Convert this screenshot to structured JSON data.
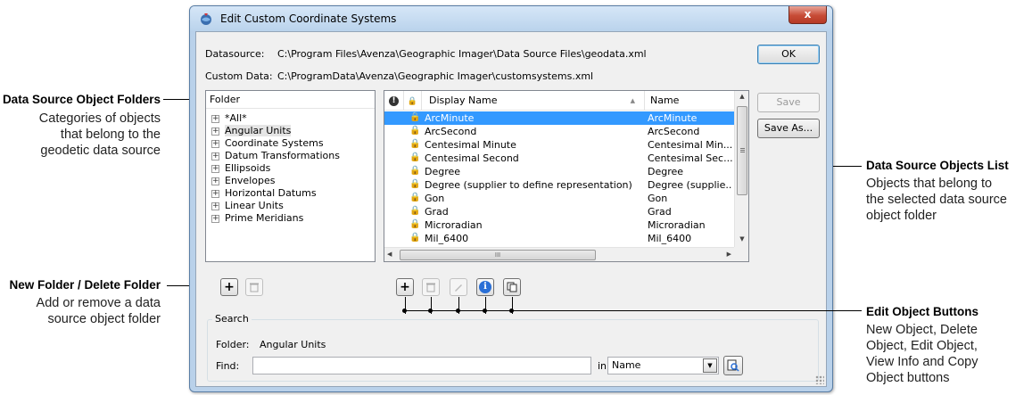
{
  "window": {
    "title": "Edit Custom Coordinate Systems",
    "close_glyph": "x"
  },
  "datasource": {
    "label": "Datasource:",
    "value": "C:\\Program Files\\Avenza\\Geographic Imager\\Data Source Files\\geodata.xml"
  },
  "custom_data": {
    "label": "Custom Data:",
    "value": "C:\\ProgramData\\Avenza\\Geographic Imager\\customsystems.xml"
  },
  "buttons": {
    "ok": "OK",
    "save": "Save",
    "save_as": "Save As..."
  },
  "folder_tree": {
    "header": "Folder",
    "items": [
      {
        "label": "*All*",
        "selected": false
      },
      {
        "label": "Angular Units",
        "selected": true
      },
      {
        "label": "Coordinate Systems",
        "selected": false
      },
      {
        "label": "Datum Transformations",
        "selected": false
      },
      {
        "label": "Ellipsoids",
        "selected": false
      },
      {
        "label": "Envelopes",
        "selected": false
      },
      {
        "label": "Horizontal Datums",
        "selected": false
      },
      {
        "label": "Linear Units",
        "selected": false
      },
      {
        "label": "Prime Meridians",
        "selected": false
      }
    ]
  },
  "objects_list": {
    "headers": {
      "display_name": "Display Name",
      "name": "Name"
    },
    "rows": [
      {
        "display": "ArcMinute",
        "name": "ArcMinute",
        "selected": true
      },
      {
        "display": "ArcSecond",
        "name": "ArcSecond",
        "selected": false
      },
      {
        "display": "Centesimal Minute",
        "name": "Centesimal Min...",
        "selected": false
      },
      {
        "display": "Centesimal Second",
        "name": "Centesimal Sec...",
        "selected": false
      },
      {
        "display": "Degree",
        "name": "Degree",
        "selected": false
      },
      {
        "display": "Degree (supplier to define representation)",
        "name": "Degree (supplie...",
        "selected": false
      },
      {
        "display": "Gon",
        "name": "Gon",
        "selected": false
      },
      {
        "display": "Grad",
        "name": "Grad",
        "selected": false
      },
      {
        "display": "Microradian",
        "name": "Microradian",
        "selected": false
      },
      {
        "display": "Mil_6400",
        "name": "Mil_6400",
        "selected": false
      }
    ],
    "hscroll_grip": "III"
  },
  "search": {
    "group_label": "Search",
    "folder_label": "Folder:",
    "folder_value": "Angular Units",
    "find_label": "Find:",
    "find_value": "",
    "in_label": "in",
    "in_value": "Name"
  },
  "annotations": {
    "folders": {
      "title": "Data Source Object Folders",
      "desc": [
        "Categories of objects",
        "that belong to the",
        "geodetic data source"
      ]
    },
    "new_delete": {
      "title": "New Folder / Delete Folder",
      "desc": [
        "Add or remove a data",
        "source object folder"
      ]
    },
    "objects_list": {
      "title": "Data Source Objects List",
      "desc": [
        "Objects that belong to",
        "the selected data source",
        "object folder"
      ]
    },
    "edit_buttons": {
      "title": "Edit Object Buttons",
      "desc": [
        "New Object, Delete",
        "Object, Edit Object,",
        "View Info and Copy",
        "Object buttons"
      ]
    }
  },
  "icons": {
    "plus": "+",
    "lock": "🔒",
    "info": "i",
    "sort_up": "▲",
    "scroll_up": "▲",
    "scroll_down": "▼",
    "scroll_left": "◀",
    "scroll_right": "▶",
    "dropdown": "▼"
  },
  "colors": {
    "selection": "#3399ff",
    "info_blue": "#2a6fd6"
  }
}
